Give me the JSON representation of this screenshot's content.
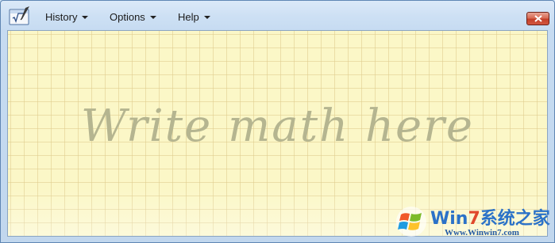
{
  "menus": [
    {
      "label": "History"
    },
    {
      "label": "Options"
    },
    {
      "label": "Help"
    }
  ],
  "canvas": {
    "prompt": "Write math here"
  },
  "watermark": {
    "title_win": "Win",
    "title_seven": "7",
    "title_rest": "系统之家",
    "url": "Www.Winwin7.com"
  },
  "colors": {
    "canvas_bg": "#fbf7c7",
    "grid_line": "#decb8b",
    "prompt_text": "#b5b590",
    "close_button": "#c4402a"
  },
  "icons": [
    "math-input-app-icon",
    "close-icon",
    "windows-logo-icon"
  ]
}
